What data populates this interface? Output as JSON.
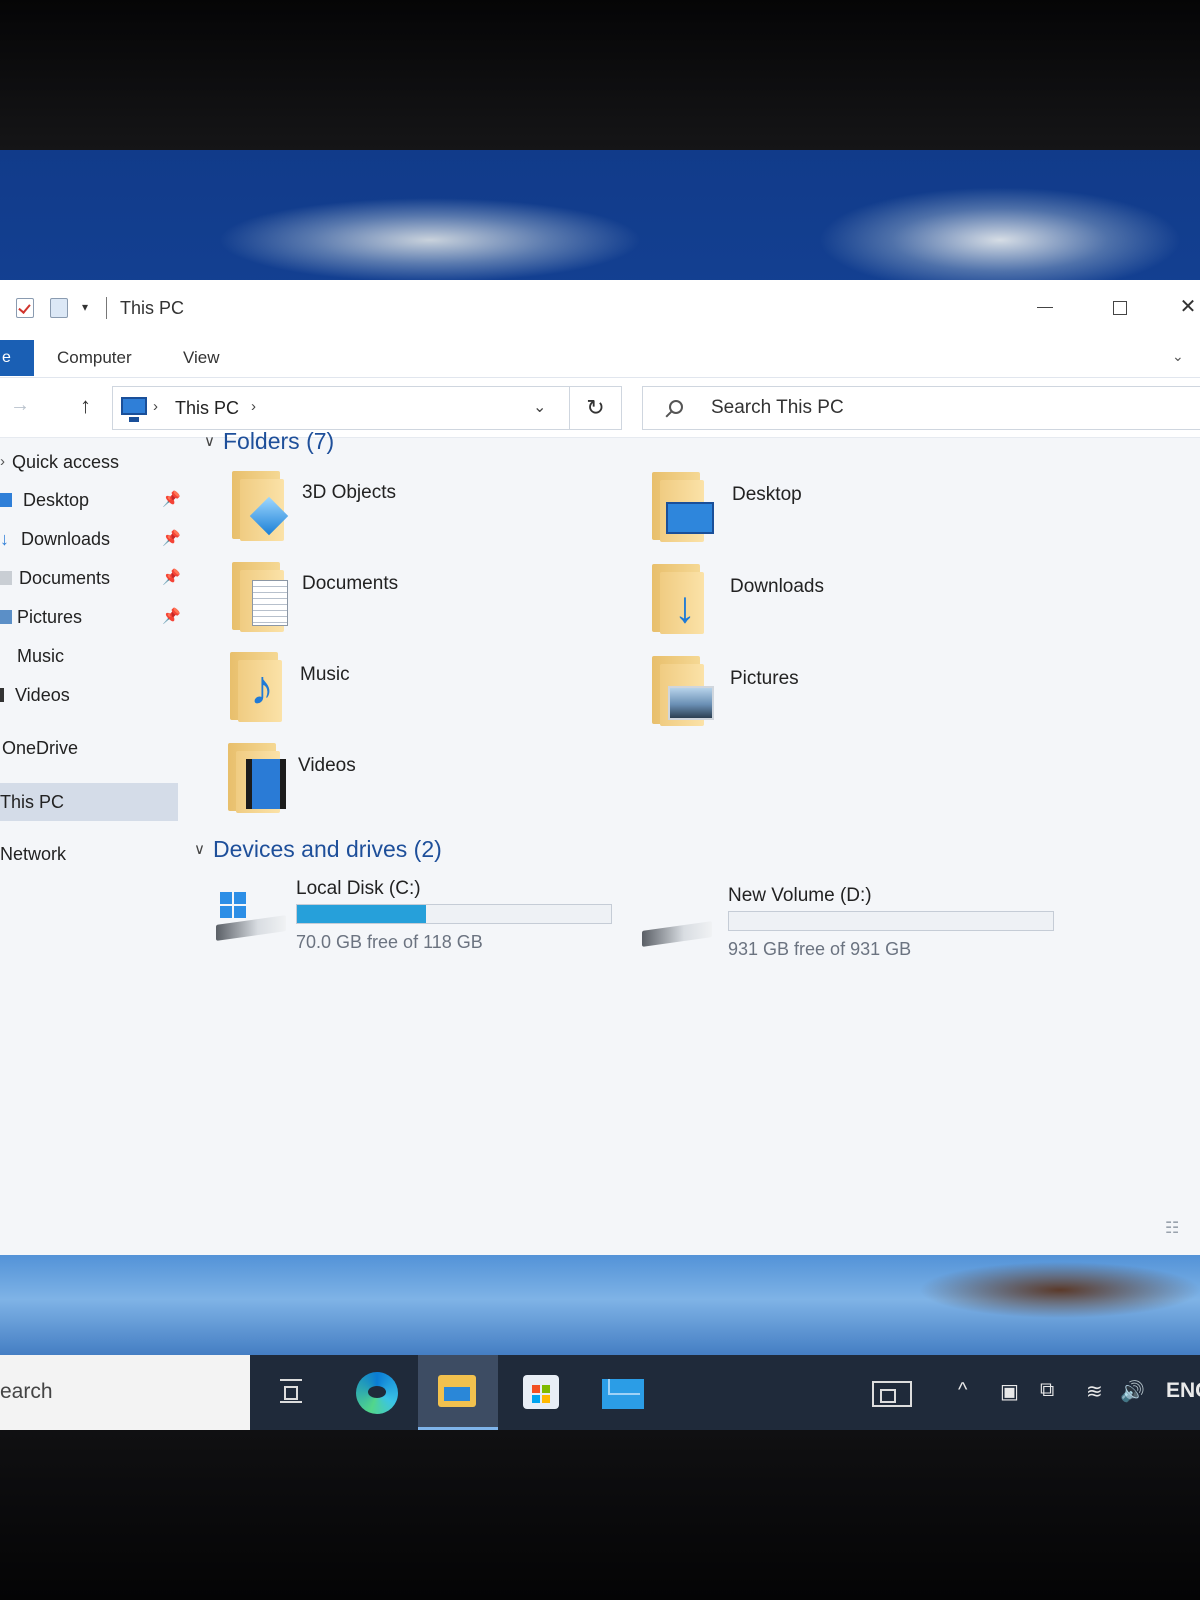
{
  "window": {
    "title": "This PC",
    "ribbon_tabs": [
      "Computer",
      "View"
    ],
    "file_tab_fragment": "e"
  },
  "address": {
    "location": "This PC",
    "search_placeholder": "Search This PC"
  },
  "sidebar": {
    "quick_access": "Quick access",
    "pinned": [
      {
        "label": "Desktop",
        "icon": "desktop-icon",
        "color": "#2f7fd8"
      },
      {
        "label": "Downloads",
        "icon": "downloads-icon",
        "color": "#2f7fd8"
      },
      {
        "label": "Documents",
        "icon": "documents-icon",
        "color": "#9aa3ad"
      },
      {
        "label": "Pictures",
        "icon": "pictures-icon",
        "color": "#5b8fc7"
      }
    ],
    "libraries": [
      {
        "label": "Music",
        "icon": "music-icon"
      },
      {
        "label": "Videos",
        "icon": "videos-icon"
      }
    ],
    "onedrive": "OneDrive",
    "this_pc": "This PC",
    "network": "Network"
  },
  "folders": {
    "header": "Folders (7)",
    "items": [
      {
        "label": "3D Objects",
        "icon": "3d-objects-folder-icon"
      },
      {
        "label": "Desktop",
        "icon": "desktop-folder-icon"
      },
      {
        "label": "Documents",
        "icon": "documents-folder-icon"
      },
      {
        "label": "Downloads",
        "icon": "downloads-folder-icon"
      },
      {
        "label": "Music",
        "icon": "music-folder-icon"
      },
      {
        "label": "Pictures",
        "icon": "pictures-folder-icon"
      },
      {
        "label": "Videos",
        "icon": "videos-folder-icon"
      }
    ]
  },
  "drives": {
    "header": "Devices and drives (2)",
    "items": [
      {
        "name": "Local Disk (C:)",
        "free_text": "70.0 GB free of 118 GB",
        "used_fraction": 0.41,
        "icon": "windows-drive-icon"
      },
      {
        "name": "New Volume (D:)",
        "free_text": "931 GB free of 931 GB",
        "used_fraction": 0.0,
        "icon": "drive-icon"
      }
    ]
  },
  "taskbar": {
    "search_placeholder": "earch",
    "apps": [
      "task-view",
      "edge",
      "file-explorer",
      "microsoft-store",
      "mail"
    ],
    "active_app": "file-explorer",
    "language": "ENG"
  },
  "colors": {
    "accent": "#1a5fb4",
    "drive_fill": "#26a0da",
    "group_header": "#1e4f9a"
  }
}
